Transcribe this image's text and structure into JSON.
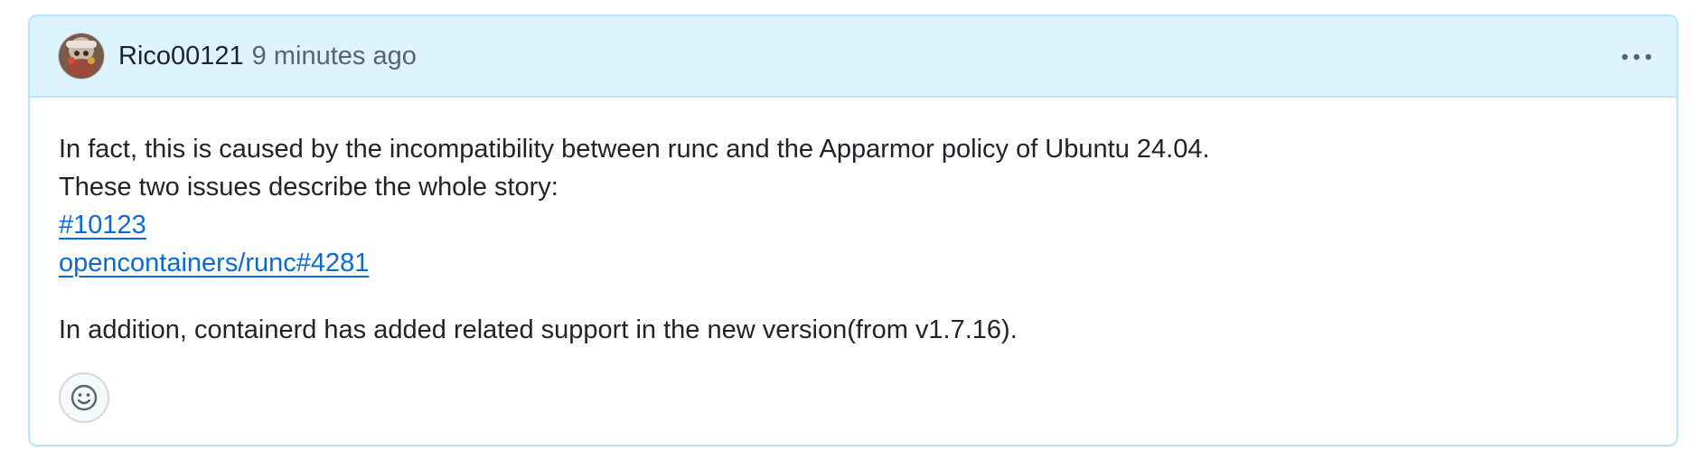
{
  "comment": {
    "author": "Rico00121",
    "timestamp": "9 minutes ago",
    "body": {
      "line1": "In fact, this is caused by the incompatibility between runc and the Apparmor policy of Ubuntu 24.04.",
      "line2": "These two issues describe the whole story:",
      "link1": "#10123",
      "link2": "opencontainers/runc#4281",
      "line3": "In addition, containerd has added related support in the new version(from v1.7.16)."
    },
    "actions": {
      "more_icon": "kebab-horizontal-icon",
      "reaction_icon": "smiley-icon"
    }
  },
  "colors": {
    "header_bg": "#ddf4ff",
    "border": "#b6e3ff",
    "link": "#0969da",
    "text": "#1f2328",
    "muted": "#59636e"
  }
}
